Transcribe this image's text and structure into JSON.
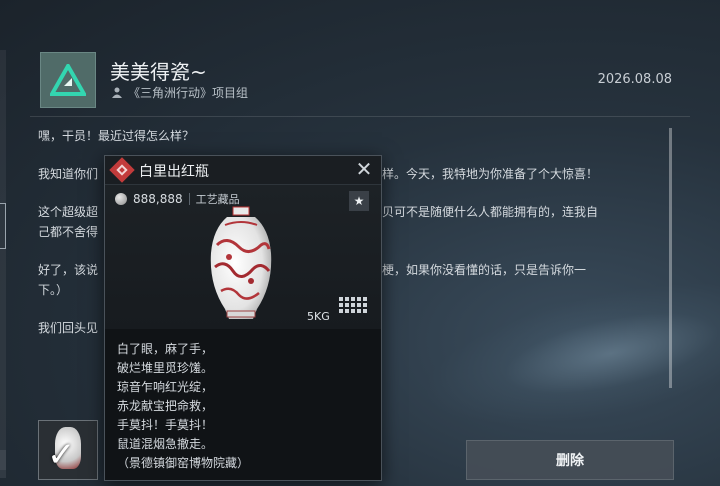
{
  "header": {
    "title": "美美得瓷~",
    "subtitle": "《三角洲行动》项目组",
    "date": "2026.08.08",
    "logo_icon": "delta-triangle-logo"
  },
  "message": {
    "paragraphs": [
      "嘿，干员！最近过得怎么样？",
      "我知道你们",
      "这个超级超",
      "己都不舍得",
      "好了，该说",
      "下。）",
      "我们回头见"
    ],
    "visible_right_fragments": [
      "天可不一样。今天，我特地为你准备了个大惊喜！",
      "了！这宝贝可不是随便什么人都能拥有的，连我自",
      "是个谐音梗，如果你没看懂的话，只是告诉你一"
    ]
  },
  "item_card": {
    "name": "白里出红瓶",
    "price": "888,888",
    "category": "工艺藏品",
    "weight": "5KG",
    "favorite_icon": "star-icon",
    "close_icon": "close-icon",
    "poem_lines": [
      "白了眼，麻了手，",
      "破烂堆里觅珍馐。",
      "琼音乍响红光绽，",
      "赤龙献宝把命救，",
      "手莫抖！手莫抖！",
      "鼠道混烟急撤走。",
      "（景德镇御窑博物院藏）"
    ]
  },
  "attachment": {
    "check_icon": "checkmark-icon"
  },
  "buttons": {
    "delete_label": "删除"
  },
  "colors": {
    "background": "#26323d",
    "card_bg": "#101316",
    "accent_red": "#c23b3b",
    "logo_bg": "#506b68"
  }
}
